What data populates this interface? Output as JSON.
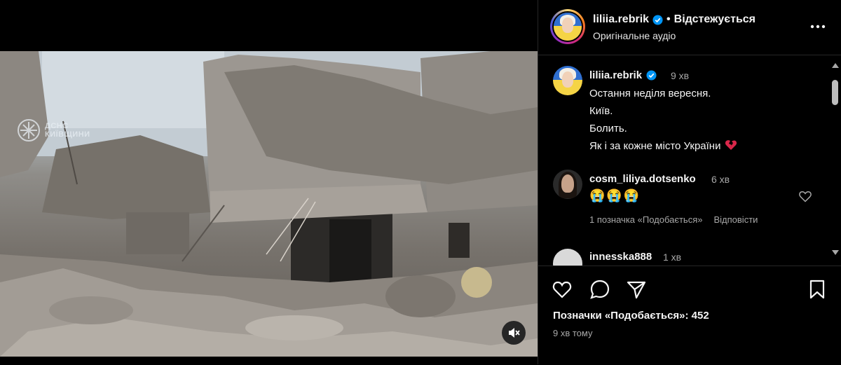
{
  "post": {
    "author": "liliia.rebrik",
    "separator": "•",
    "follow_status": "Відстежується",
    "audio": "Оригінальне аудіо"
  },
  "video": {
    "watermark_line1": "ДСНС",
    "watermark_line2": "КИЇВЩИНИ"
  },
  "caption": {
    "author": "liliia.rebrik",
    "time": "9 хв",
    "lines": [
      "Остання неділя вересня.",
      "Київ.",
      "Болить.",
      "Як і за кожне місто України"
    ]
  },
  "comments": [
    {
      "author": "cosm_liliya.dotsenko",
      "time": "6 хв",
      "text": "😭😭😭",
      "likes_label": "1 позначка «Подобається»",
      "reply_label": "Відповісти"
    },
    {
      "author": "innesska888",
      "time": "1 хв"
    }
  ],
  "footer": {
    "likes": "Позначки «Подобається»: 452",
    "posted": "9 хв тому"
  },
  "colors": {
    "background": "#000000",
    "text": "#f5f5f5",
    "muted": "#a8a8a8",
    "verified": "#0095f6",
    "divider": "#262626"
  },
  "icons": [
    "verified-icon",
    "more-icon",
    "broken-heart-icon",
    "like-icon",
    "comment-icon",
    "share-icon",
    "save-icon",
    "mute-icon"
  ]
}
